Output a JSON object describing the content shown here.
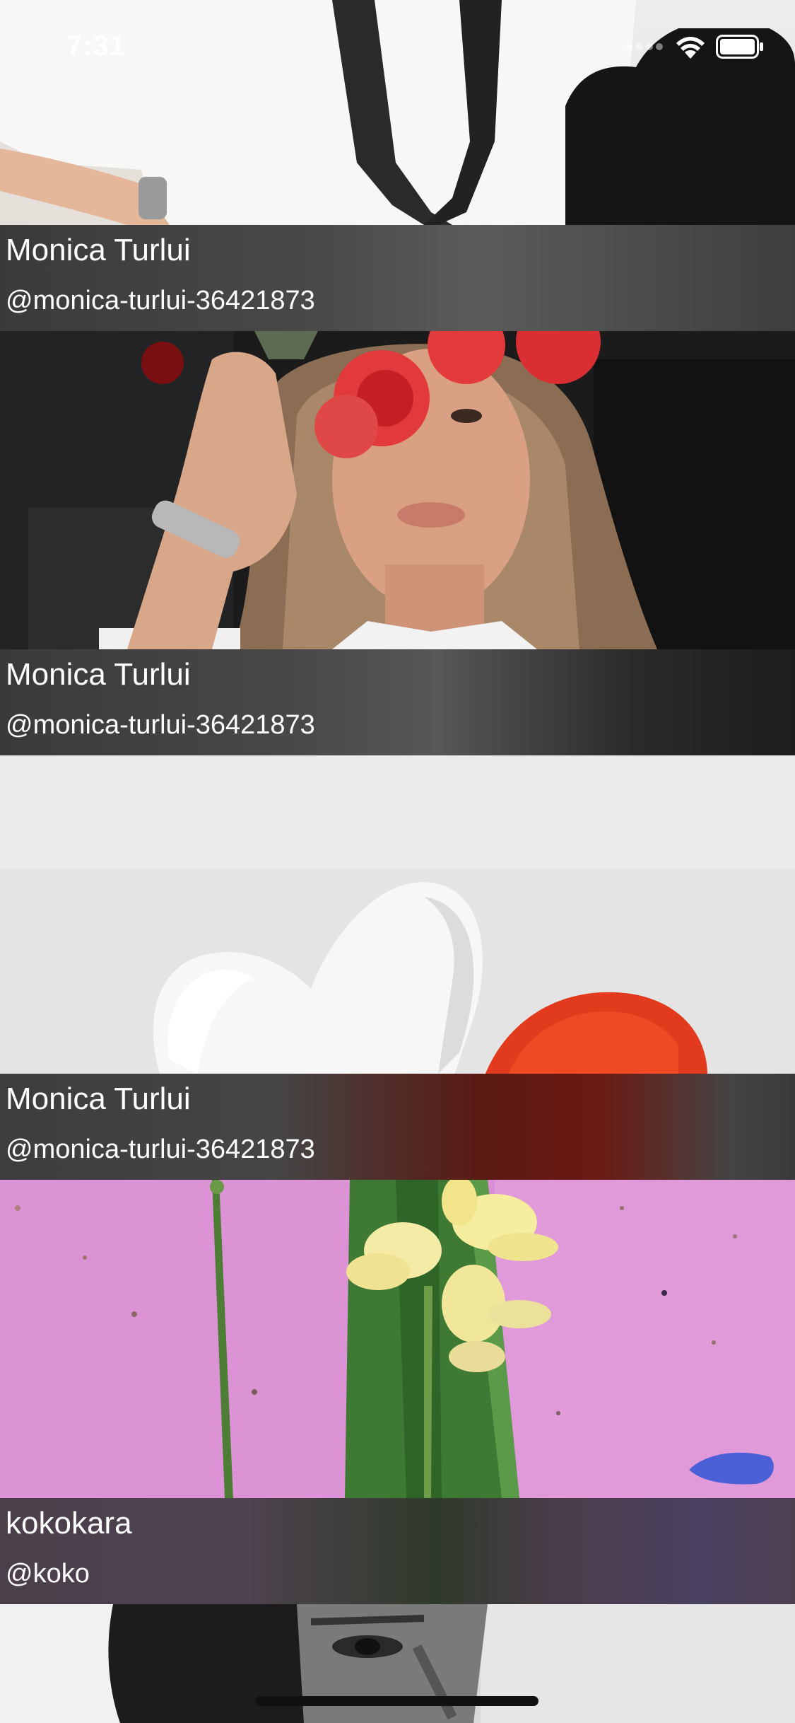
{
  "status_bar": {
    "time": "7:31",
    "icons": [
      "signal-dots-icon",
      "wifi-icon",
      "battery-icon"
    ]
  },
  "feed": {
    "cards": [
      {
        "name": "Monica Turlui",
        "handle": "@monica-turlui-36421873",
        "image": "woman-white-shirt-photo"
      },
      {
        "name": "Monica Turlui",
        "handle": "@monica-turlui-36421873",
        "image": "woman-red-roses-photo"
      },
      {
        "name": "Monica Turlui",
        "handle": "@monica-turlui-36421873",
        "image": "heart-balloons-photo"
      },
      {
        "name": "kokokara",
        "handle": "@koko",
        "image": "yellow-flowers-pink-photo"
      },
      {
        "name": "",
        "handle": "",
        "image": "bw-portrait-photo"
      }
    ]
  },
  "colors": {
    "caption_overlay": "#2b2b2b",
    "text": "#ffffff",
    "pink_background": "#d98fd4",
    "leaf_green": "#3f7a34"
  }
}
